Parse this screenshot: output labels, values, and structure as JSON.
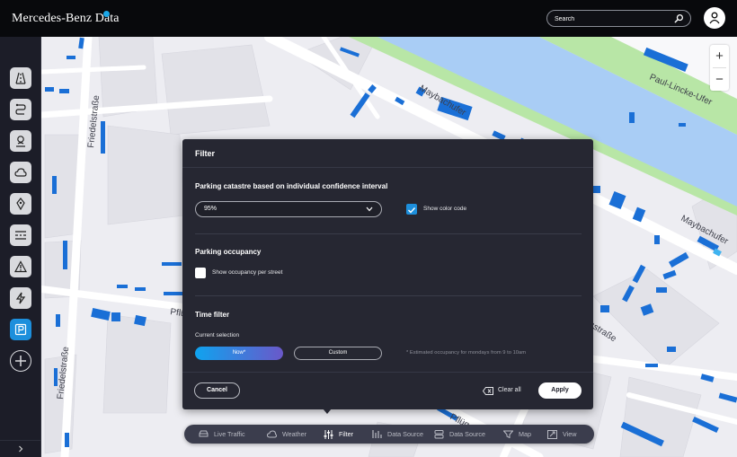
{
  "app": {
    "brand": "Mercedes-Benz Data",
    "search_placeholder": "Search"
  },
  "sidebar": {
    "items": [
      {
        "name": "road-icon"
      },
      {
        "name": "route-icon"
      },
      {
        "name": "person-location-icon"
      },
      {
        "name": "weather-icon"
      },
      {
        "name": "location-pin-icon"
      },
      {
        "name": "lanes-icon"
      },
      {
        "name": "warning-icon"
      },
      {
        "name": "lightning-icon"
      },
      {
        "name": "parking-icon",
        "active": true
      },
      {
        "name": "add-icon"
      }
    ]
  },
  "map": {
    "streets": [
      {
        "label": "Maybachufer"
      },
      {
        "label": "Paul-Lincke-Ufer"
      },
      {
        "label": "Friedelstraße"
      },
      {
        "label": "Friedelstraße"
      },
      {
        "label": "Maybachufer"
      },
      {
        "label": "Pflü"
      },
      {
        "label": "Pflüg"
      },
      {
        "label": "sstraße"
      }
    ],
    "zoom_in": "+",
    "zoom_out": "−"
  },
  "filter": {
    "title": "Filter",
    "catastre": {
      "title": "Parking catastre based on individual confidence interval",
      "selected": "95%",
      "show_color_code_label": "Show color code",
      "show_color_code_checked": true
    },
    "occupancy": {
      "title": "Parking occupancy",
      "show_per_street_label": "Show occupancy per street",
      "show_per_street_checked": false
    },
    "time": {
      "title": "Time filter",
      "current_selection_label": "Current selection",
      "now_label": "Now*",
      "custom_label": "Custom",
      "note": "* Estimated occupancy for mondays from 9 to 10am"
    },
    "cancel_label": "Cancel",
    "clear_all_label": "Clear all",
    "apply_label": "Apply"
  },
  "bottom_nav": {
    "items": [
      {
        "label": "Live Traffic",
        "icon": "car-icon"
      },
      {
        "label": "Weather",
        "icon": "weather-icon"
      },
      {
        "label": "Filter",
        "icon": "filter-icon",
        "active": true
      },
      {
        "label": "Data Source",
        "icon": "data-source-icon"
      },
      {
        "label": "Data Source",
        "icon": "layers-icon"
      },
      {
        "label": "Map",
        "icon": "map-icon"
      },
      {
        "label": "View",
        "icon": "view-icon"
      }
    ]
  },
  "colors": {
    "accent": "#1d8fdc",
    "parking_bar": "#1a6fd6",
    "water": "#a9cdf5",
    "park": "#b8e6a6"
  }
}
